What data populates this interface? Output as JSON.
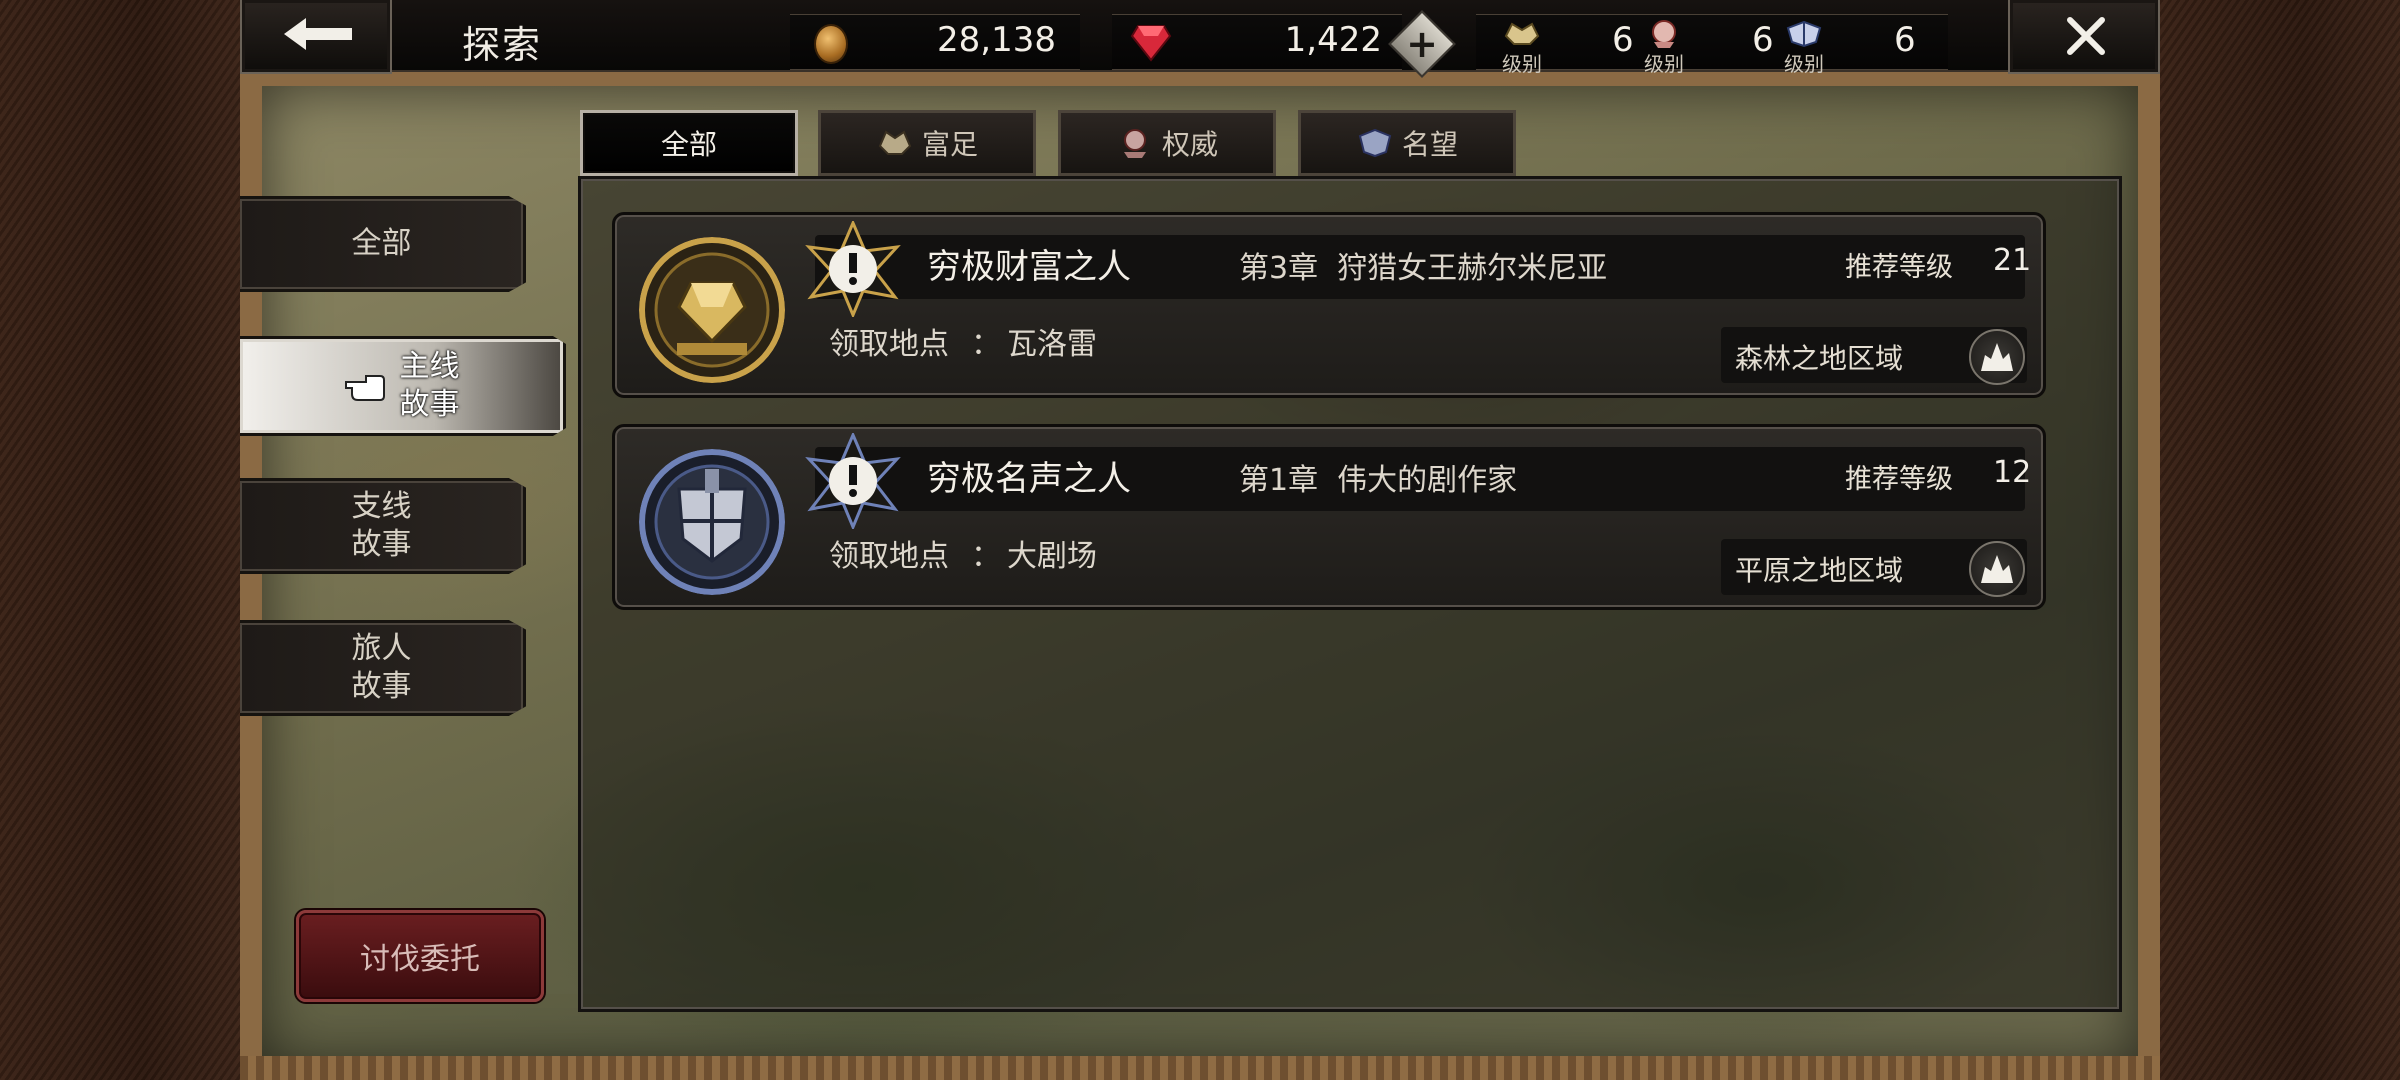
{
  "header": {
    "title": "探索",
    "gold": "28,138",
    "gems": "1,422",
    "plus_label": "+",
    "levels": [
      {
        "label": "级别",
        "value": "6",
        "icon": "wealth-crest-icon"
      },
      {
        "label": "级别",
        "value": "6",
        "icon": "power-crest-icon"
      },
      {
        "label": "级别",
        "value": "6",
        "icon": "fame-crest-icon"
      }
    ]
  },
  "tabs": [
    {
      "label": "全部",
      "icon": ""
    },
    {
      "label": "富足",
      "icon": "wealth-icon"
    },
    {
      "label": "权威",
      "icon": "power-icon"
    },
    {
      "label": "名望",
      "icon": "fame-icon"
    }
  ],
  "categories": [
    {
      "label": "全部"
    },
    {
      "label": "主线\n故事"
    },
    {
      "label": "支线\n故事"
    },
    {
      "label": "旅人\n故事"
    }
  ],
  "commission_button": "讨伐委托",
  "quests": [
    {
      "name": "穷极财富之人",
      "chapter": "第3章  狩猎女王赫尔米尼亚",
      "recommended_label": "推荐等级",
      "recommended_level": "21",
      "location_label": "领取地点",
      "location_colon": "：",
      "location": "瓦洛雷",
      "region": "森林之地区域",
      "emblem": "wealth-emblem-icon",
      "accent": "#c9a24a"
    },
    {
      "name": "穷极名声之人",
      "chapter": "第1章  伟大的剧作家",
      "recommended_label": "推荐等级",
      "recommended_level": "12",
      "location_label": "领取地点",
      "location_colon": "：",
      "location": "大剧场",
      "region": "平原之地区域",
      "emblem": "fame-emblem-icon",
      "accent": "#6f82b8"
    }
  ]
}
